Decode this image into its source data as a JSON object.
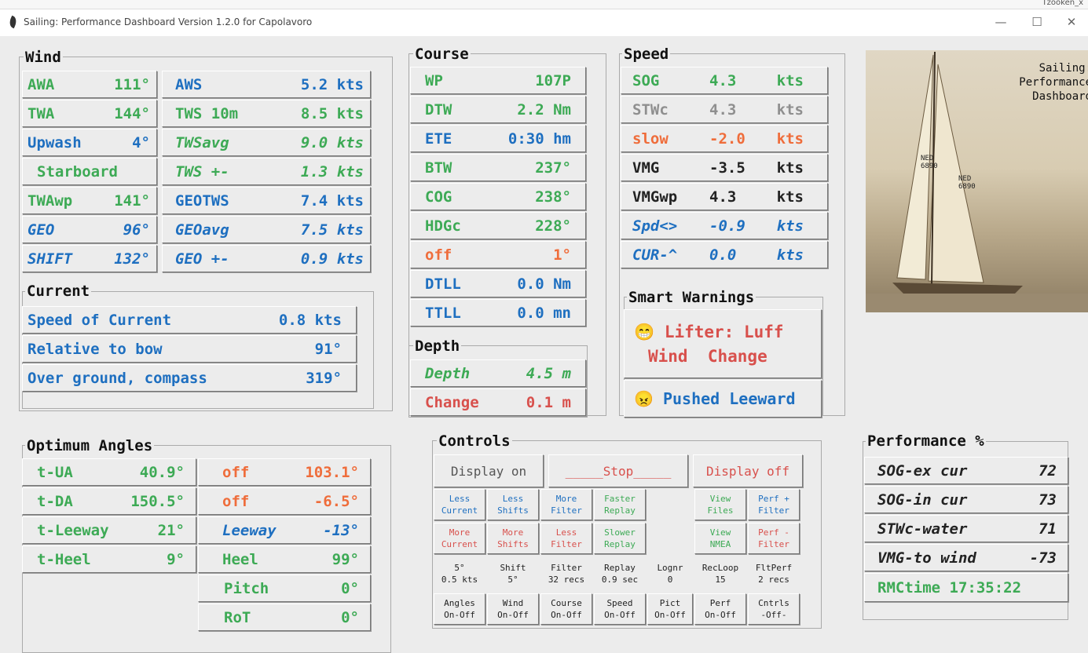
{
  "window": {
    "title": "Sailing: Performance Dashboard Version 1.2.0 for Capolavoro",
    "minimize": "—",
    "maximize": "☐",
    "close": "✕",
    "background_text": "Tzooken_x"
  },
  "wind": {
    "label": "Wind",
    "left": [
      {
        "k": "AWA",
        "v": "111°"
      },
      {
        "k": "TWA",
        "v": "144°"
      },
      {
        "k": "Upwash",
        "v": "4°"
      },
      {
        "k": "Starboard",
        "v": ""
      },
      {
        "k": "TWAwp",
        "v": "141°"
      },
      {
        "k": "GEO",
        "v": "96°"
      },
      {
        "k": "SHIFT",
        "v": "132°"
      }
    ],
    "right": [
      {
        "k": "AWS",
        "v": "5.2 kts"
      },
      {
        "k": "TWS 10m",
        "v": "8.5 kts"
      },
      {
        "k": "TWSavg",
        "v": "9.0 kts"
      },
      {
        "k": "TWS +-",
        "v": "1.3 kts"
      },
      {
        "k": "GEOTWS",
        "v": "7.4 kts"
      },
      {
        "k": "GEOavg",
        "v": "7.5 kts"
      },
      {
        "k": "GEO +-",
        "v": "0.9 kts"
      }
    ]
  },
  "current": {
    "label": "Current",
    "rows": [
      {
        "k": "Speed of Current",
        "v": "0.8 kts"
      },
      {
        "k": "Relative to bow",
        "v": "91°"
      },
      {
        "k": "Over ground, compass",
        "v": "319°"
      }
    ]
  },
  "course": {
    "label": "Course",
    "rows": [
      {
        "k": "WP",
        "v": "107P"
      },
      {
        "k": "DTW",
        "v": "2.2 Nm"
      },
      {
        "k": "ETE",
        "v": "0:30 hm"
      },
      {
        "k": "BTW",
        "v": "237°"
      },
      {
        "k": "COG",
        "v": "238°"
      },
      {
        "k": "HDGc",
        "v": "228°"
      },
      {
        "k": "off",
        "v": "1°"
      },
      {
        "k": "DTLL",
        "v": "0.0 Nm"
      },
      {
        "k": "TTLL",
        "v": "0.0 mn"
      }
    ]
  },
  "depth": {
    "label": "Depth",
    "rows": [
      {
        "k": "Depth",
        "v": "4.5 m"
      },
      {
        "k": "Change",
        "v": "0.1 m"
      }
    ]
  },
  "speed": {
    "label": "Speed",
    "rows": [
      {
        "k": "SOG",
        "v": "4.3",
        "u": "kts"
      },
      {
        "k": "STWc",
        "v": "4.3",
        "u": "kts"
      },
      {
        "k": "slow",
        "v": "-2.0",
        "u": "kts"
      },
      {
        "k": "VMG",
        "v": "-3.5",
        "u": "kts"
      },
      {
        "k": "VMGwp",
        "v": "4.3",
        "u": "kts"
      },
      {
        "k": "Spd<>",
        "v": "-0.9",
        "u": "kts"
      },
      {
        "k": "CUR-^",
        "v": "0.0",
        "u": "kts"
      }
    ]
  },
  "warnings": {
    "label": "Smart Warnings",
    "w1_icon": "😁",
    "w1": "Lifter: Luff",
    "w1b": "Wind  Change",
    "w2_icon": "😠",
    "w2": "Pushed Leeward"
  },
  "photo": {
    "caption": "Sailing:\nPerformance\nDashboard",
    "sail_numbers": [
      "NED\n6890",
      "NED\n6890"
    ]
  },
  "optimum": {
    "label": "Optimum Angles",
    "left": [
      {
        "k": "t-UA",
        "v": "40.9°"
      },
      {
        "k": "t-DA",
        "v": "150.5°"
      },
      {
        "k": "t-Leeway",
        "v": "21°"
      },
      {
        "k": "t-Heel",
        "v": "9°"
      }
    ],
    "right": [
      {
        "k": "off",
        "v": "103.1°"
      },
      {
        "k": "off",
        "v": "-6.5°"
      },
      {
        "k": "Leeway",
        "v": "-13°"
      },
      {
        "k": "Heel",
        "v": "99°"
      },
      {
        "k": "Pitch",
        "v": "0°"
      },
      {
        "k": "RoT",
        "v": "0°"
      }
    ]
  },
  "controls": {
    "label": "Controls",
    "display_on": "Display on",
    "stop": "_____Stop_____",
    "display_off": "Display off",
    "row1": [
      "Less\nCurrent",
      "Less\nShifts",
      "More\nFilter",
      "Faster\nReplay",
      "View\nFiles",
      "Perf +\nFilter"
    ],
    "row2": [
      "More\nCurrent",
      "More\nShifts",
      "Less\nFilter",
      "Slower\nReplay",
      "View\nNMEA",
      "Perf -\nFilter"
    ],
    "status": [
      "5°\n0.5 kts",
      "Shift\n5°",
      "Filter\n32 recs",
      "Replay\n0.9 sec",
      "Lognr\n0",
      "RecLoop\n15",
      "FltPerf\n2 recs"
    ],
    "toggles": [
      "Angles\nOn-Off",
      "Wind\nOn-Off",
      "Course\nOn-Off",
      "Speed\nOn-Off",
      "Pict\nOn-Off",
      "Perf\nOn-Off",
      "Cntrls\n-Off-"
    ]
  },
  "performance": {
    "label": "Performance %",
    "rows": [
      {
        "k": "SOG-ex cur",
        "v": "72"
      },
      {
        "k": "SOG-in cur",
        "v": "73"
      },
      {
        "k": "STWc-water",
        "v": "71"
      },
      {
        "k": "VMG-to wind",
        "v": "-73"
      }
    ],
    "rmc": "RMCtime 17:35:22"
  },
  "colors": {
    "green": "#3daa55",
    "blue": "#1e6fc0",
    "orange": "#ef6d3b",
    "gray": "#8f8f8f",
    "red": "#d8504c"
  }
}
